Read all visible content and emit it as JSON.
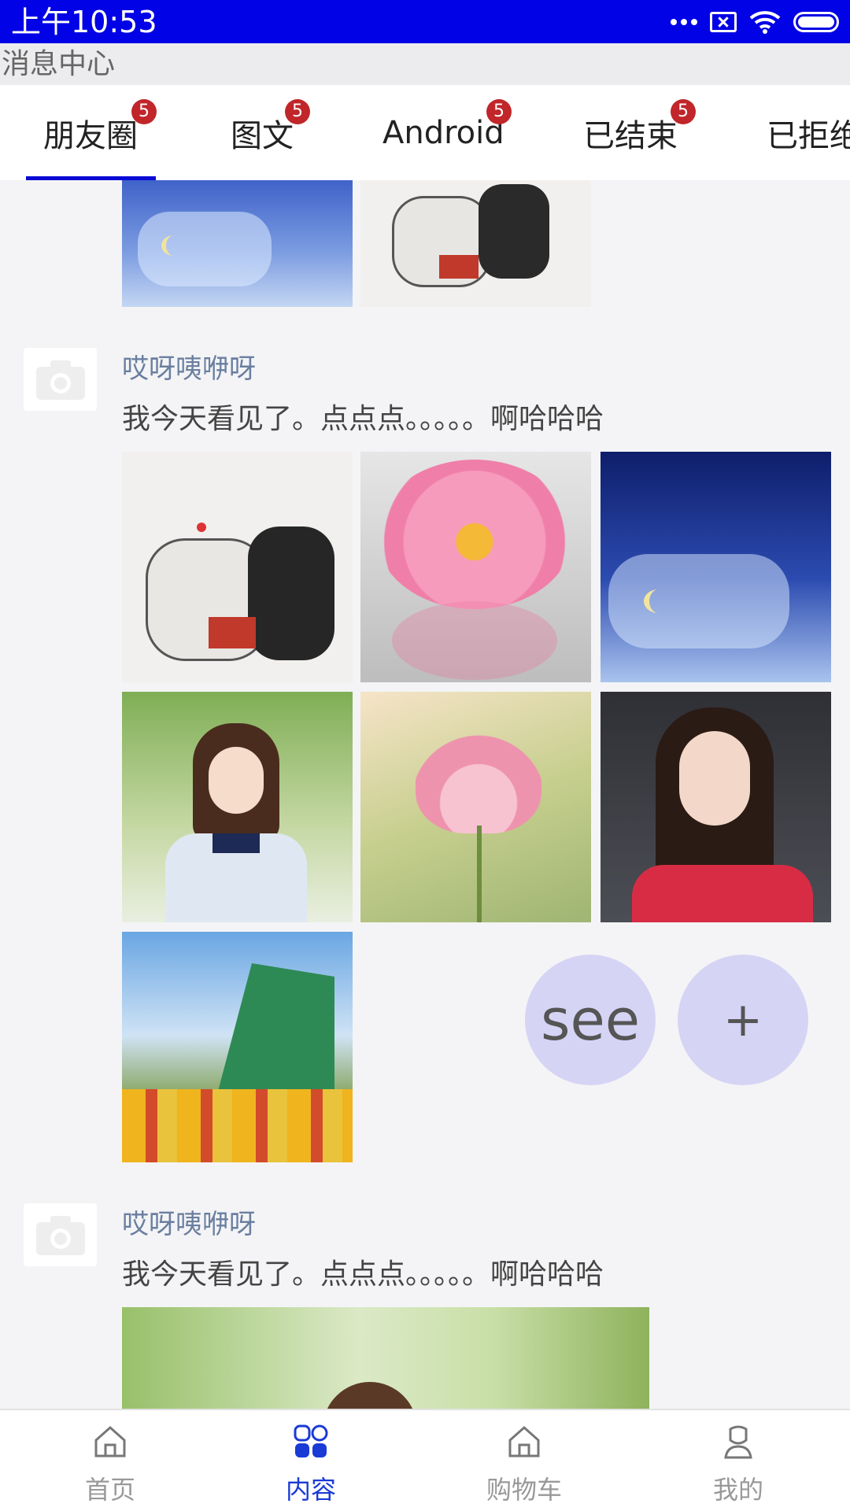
{
  "status_bar": {
    "time": "上午10:53"
  },
  "header": {
    "title": "消息中心"
  },
  "tabs": [
    {
      "label": "朋友圈",
      "badge": "5"
    },
    {
      "label": "图文",
      "badge": "5"
    },
    {
      "label": "Android",
      "badge": "5"
    },
    {
      "label": "已结束",
      "badge": "5"
    },
    {
      "label": "已拒绝"
    }
  ],
  "posts": [
    {
      "author": "哎呀咦咿呀",
      "text": "我今天看见了。点点点。。。。。啊哈哈哈"
    },
    {
      "author": "哎呀咦咿呀",
      "text": "我今天看见了。点点点。。。。。啊哈哈哈"
    }
  ],
  "fabs": {
    "see_label": "see",
    "add_label": "+"
  },
  "bottom_nav": [
    {
      "label": "首页",
      "icon": "home-icon"
    },
    {
      "label": "内容",
      "icon": "grid-icon",
      "active": true
    },
    {
      "label": "购物车",
      "icon": "cart-icon"
    },
    {
      "label": "我的",
      "icon": "profile-icon"
    }
  ],
  "colors": {
    "status_bar": "#0202e6",
    "accent": "#0a0ad6",
    "badge": "#c0262a",
    "fab": "#d6d4f5"
  }
}
